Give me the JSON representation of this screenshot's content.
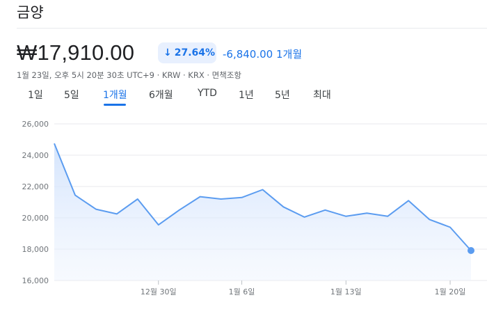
{
  "title": "금양",
  "price": "₩17,910.00",
  "change_percent": "27.64%",
  "change_direction_icon": "arrow-down-icon",
  "change_absolute": "-6,840.00 1개월",
  "meta": "1월 23일, 오후 5시 20분 30초 UTC+9 · KRW · KRX · 면책조항",
  "tabs": [
    {
      "label": "1일"
    },
    {
      "label": "5일"
    },
    {
      "label": "1개월"
    },
    {
      "label": "6개월"
    },
    {
      "label": "YTD"
    },
    {
      "label": "1년"
    },
    {
      "label": "5년"
    },
    {
      "label": "최대"
    }
  ],
  "active_tab": "1개월",
  "colors": {
    "accent": "#1a73e8",
    "line": "#5b9cf0",
    "fill": "#dde8fb"
  },
  "chart_data": {
    "type": "area",
    "x_tick_labels": [
      "12월 30일",
      "1월 6일",
      "1월 13일",
      "1월 20일"
    ],
    "y_tick_labels": [
      "26,000",
      "24,000",
      "22,000",
      "20,000",
      "18,000",
      "16,000"
    ],
    "ylim": [
      16000,
      26000
    ],
    "grid": true,
    "series": [
      {
        "values": [
          24750,
          21450,
          20550,
          20250,
          21200,
          19550,
          20500,
          21350,
          21200,
          21300,
          21800,
          20700,
          20050,
          20500,
          20100,
          20300,
          20100,
          21100,
          19900,
          19400,
          17910
        ]
      }
    ]
  }
}
